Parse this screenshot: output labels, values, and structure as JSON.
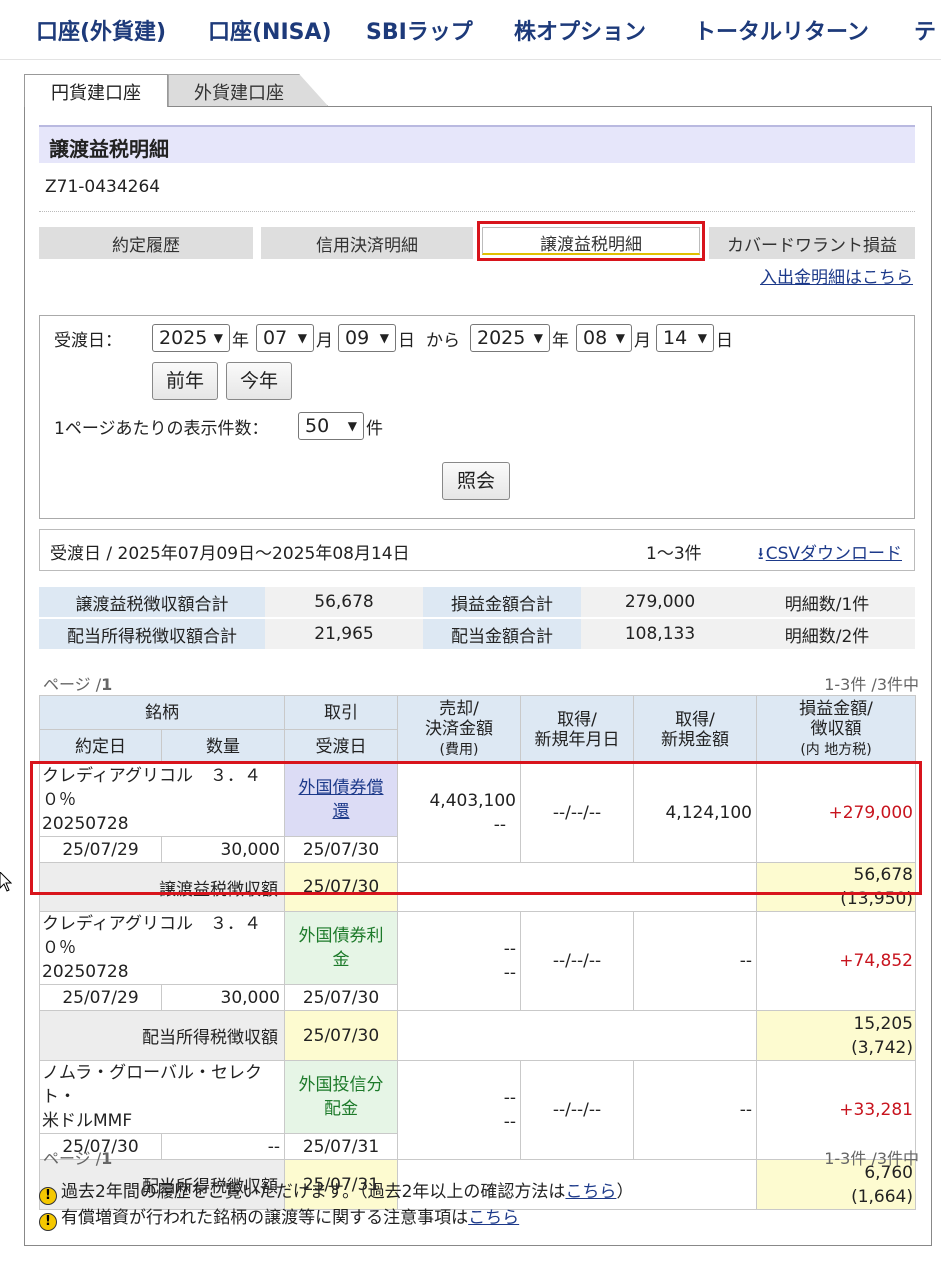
{
  "topnav": {
    "items": [
      "口座(外貨建)",
      "口座(NISA)",
      "SBIラップ",
      "株オプション",
      "トータルリターン",
      "テ"
    ]
  },
  "account_tabs": {
    "active": "円貨建口座",
    "inactive": "外貨建口座"
  },
  "section_title": "譲渡益税明細",
  "account_number": "Z71-0434264",
  "subtabs": [
    "約定履歴",
    "信用決済明細",
    "譲渡益税明細",
    "カバードワラント損益"
  ],
  "deposit_link": "入出金明細はこちら",
  "form": {
    "delivery_label": "受渡日：",
    "from_year": "2025",
    "from_month": "07",
    "from_day": "09",
    "year_unit": "年",
    "month_unit": "月",
    "day_unit": "日",
    "from_word": "から",
    "to_year": "2025",
    "to_month": "08",
    "to_day": "14",
    "prev_year_button": "前年",
    "this_year_button": "今年",
    "per_page_label": "1ページあたりの表示件数：",
    "per_page_value": "50",
    "per_page_unit": "件",
    "search_button": "照会"
  },
  "range": {
    "text": "受渡日 / 2025年07月09日〜2025年08月14日",
    "count": "1〜3件",
    "csv_link": "CSVダウンロード"
  },
  "summary": [
    [
      "譲渡益税徴収額合計",
      "56,678",
      "損益金額合計",
      "279,000",
      "明細数/1件"
    ],
    [
      "配当所得税徴収額合計",
      "21,965",
      "配当金額合計",
      "108,133",
      "明細数/2件"
    ]
  ],
  "paging": {
    "page_label": "ページ /",
    "page_number": "1",
    "count": "1-3件 /3件中"
  },
  "table_headers": {
    "issue": "銘柄",
    "deal": "取引",
    "sale_line1": "売却/",
    "sale_line2": "決済金額",
    "sale_line3": "(費用)",
    "acq_date_line1": "取得/",
    "acq_date_line2": "新規年月日",
    "acq_amt_line1": "取得/",
    "acq_amt_line2": "新規金額",
    "pl_line1": "損益金額/",
    "pl_line2": "徴収額",
    "pl_line3": "(内 地方税)",
    "trade_date": "約定日",
    "quantity": "数量",
    "delivery_date": "受渡日"
  },
  "rows": [
    {
      "name_line1": "クレディアグリコル　３．４０％",
      "name_line2": "20250728",
      "deal_line1": "外国債券償",
      "deal_line2": "還",
      "sale_line1": "4,403,100",
      "sale_line2": "--",
      "acq_date": "--/--/--",
      "acq_amount": "4,124,100",
      "pl": "+279,000",
      "trade_date": "25/07/29",
      "quantity": "30,000",
      "delivery_date": "25/07/30",
      "tax_label": "譲渡益税徴収額",
      "tax_date": "25/07/30",
      "tax_amount": "56,678",
      "tax_local": "(13,950)"
    },
    {
      "name_line1": "クレディアグリコル　３．４０％",
      "name_line2": "20250728",
      "deal_line1": "外国債券利",
      "deal_line2": "金",
      "sale_line1": "--",
      "sale_line2": "--",
      "acq_date": "--/--/--",
      "acq_amount": "--",
      "pl": "+74,852",
      "trade_date": "25/07/29",
      "quantity": "30,000",
      "delivery_date": "25/07/30",
      "tax_label": "配当所得税徴収額",
      "tax_date": "25/07/30",
      "tax_amount": "15,205",
      "tax_local": "(3,742)"
    },
    {
      "name_line1": "ノムラ・グローバル・セレクト・",
      "name_line2": "米ドルMMF",
      "deal_line1": "外国投信分",
      "deal_line2": "配金",
      "sale_line1": "--",
      "sale_line2": "--",
      "acq_date": "--/--/--",
      "acq_amount": "--",
      "pl": "+33,281",
      "trade_date": "25/07/30",
      "quantity": "--",
      "delivery_date": "25/07/31",
      "tax_label": "配当所得税徴収額",
      "tax_date": "25/07/31",
      "tax_amount": "6,760",
      "tax_local": "(1,664)"
    }
  ],
  "notes": {
    "note1_text": "過去2年間の履歴をご覧いただけます。（過去2年以上の確認方法は",
    "note1_link": "こちら",
    "note1_end": "）",
    "note2_text": "有償増資が行われた銘柄の譲渡等に関する注意事項は",
    "note2_link": "こちら"
  },
  "colors": {
    "brand_navy": "#1d3a7a",
    "highlight_red": "#d8141c",
    "profit_red": "#c8141e",
    "header_blue": "#dde8f3",
    "tax_yellow": "#fdfbd0"
  }
}
